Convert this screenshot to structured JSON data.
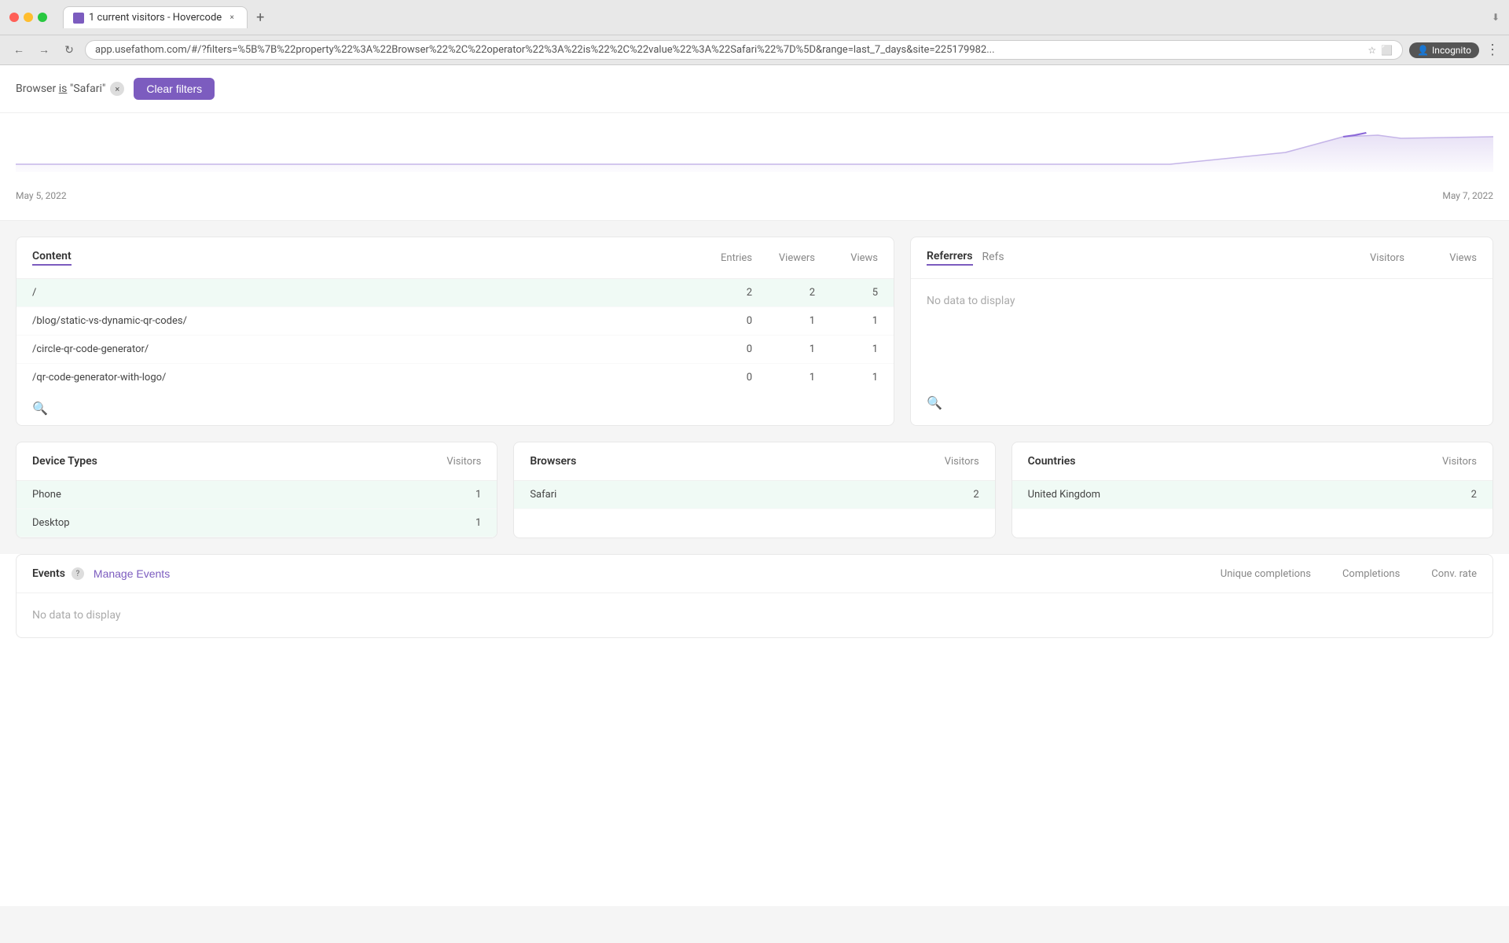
{
  "browser": {
    "tab_title": "1 current visitors - Hovercode",
    "url": "app.usefathom.com/#/?filters=%5B%7B%22property%22%3A%22Browser%22%2C%22operator%22%3A%22is%22%2C%22value%22%3A%22Safari%22%7D%5D&range=last_7_days&site=225179982...",
    "incognito_label": "Incognito",
    "new_tab_icon": "+"
  },
  "filter": {
    "label": "Browser is \"Safari\"",
    "browser_prefix": "Browser",
    "is_text": "is",
    "value": "\"Safari\"",
    "clear_button": "Clear filters"
  },
  "chart": {
    "date_left": "May 5, 2022",
    "date_right": "May 7, 2022"
  },
  "content_table": {
    "title": "Content",
    "col_entries": "Entries",
    "col_viewers": "Viewers",
    "col_views": "Views",
    "rows": [
      {
        "path": "/",
        "entries": "2",
        "viewers": "2",
        "views": "5",
        "highlighted": true
      },
      {
        "path": "/blog/static-vs-dynamic-qr-codes/",
        "entries": "0",
        "viewers": "1",
        "views": "1",
        "highlighted": false
      },
      {
        "path": "/circle-qr-code-generator/",
        "entries": "0",
        "viewers": "1",
        "views": "1",
        "highlighted": false
      },
      {
        "path": "/qr-code-generator-with-logo/",
        "entries": "0",
        "viewers": "1",
        "views": "1",
        "highlighted": false
      }
    ]
  },
  "referrers_table": {
    "tab_referrers": "Referrers",
    "tab_refs": "Refs",
    "col_visitors": "Visitors",
    "col_views": "Views",
    "no_data": "No data to display"
  },
  "device_types_table": {
    "title": "Device Types",
    "col_visitors": "Visitors",
    "rows": [
      {
        "name": "Phone",
        "visitors": "1",
        "highlighted": true
      },
      {
        "name": "Desktop",
        "visitors": "1",
        "highlighted": true
      }
    ]
  },
  "browsers_table": {
    "title": "Browsers",
    "col_visitors": "Visitors",
    "rows": [
      {
        "name": "Safari",
        "visitors": "2",
        "highlighted": true
      }
    ]
  },
  "countries_table": {
    "title": "Countries",
    "col_visitors": "Visitors",
    "rows": [
      {
        "name": "United Kingdom",
        "visitors": "2",
        "highlighted": true
      }
    ]
  },
  "events_section": {
    "title": "Events",
    "help_icon": "?",
    "manage_btn": "Manage Events",
    "col_unique": "Unique completions",
    "col_completions": "Completions",
    "col_conv_rate": "Conv. rate",
    "no_data": "No data to display"
  },
  "icons": {
    "back": "←",
    "forward": "→",
    "refresh": "↻",
    "star": "☆",
    "extension": "⬜",
    "incognito": "👤",
    "more": "⋮",
    "search": "🔍",
    "close_x": "×"
  }
}
